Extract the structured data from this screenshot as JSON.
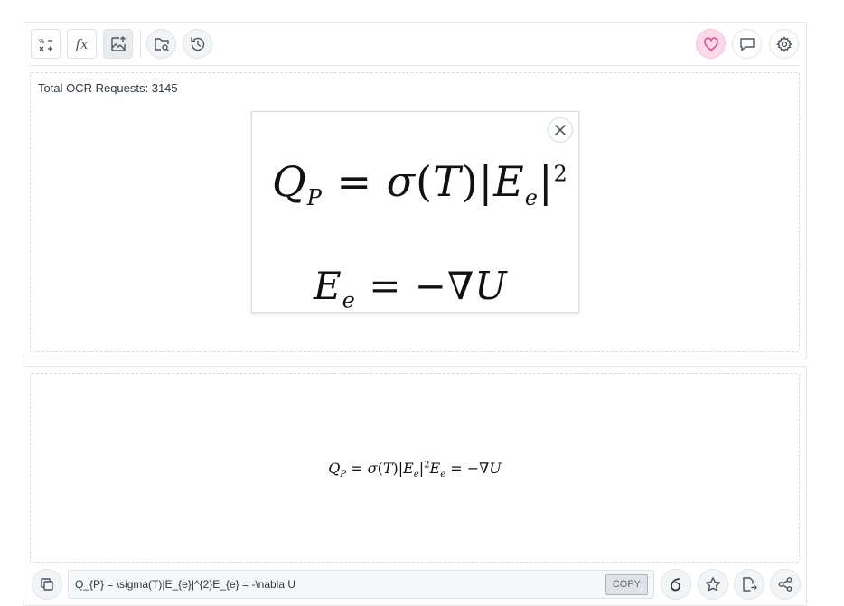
{
  "toolbar": {
    "left_buttons": [
      {
        "name": "math-symbols-icon",
        "glyph": "%−\n×+"
      },
      {
        "name": "fx-icon",
        "label": "fx"
      },
      {
        "name": "image-upload-icon"
      },
      {
        "name": "folder-search-icon"
      },
      {
        "name": "history-icon"
      }
    ],
    "right_buttons": [
      {
        "name": "heart-icon",
        "accent": "#e0468a"
      },
      {
        "name": "comment-icon"
      },
      {
        "name": "gear-icon"
      }
    ],
    "fx_label": "fx"
  },
  "ocr": {
    "counter_text": "Total OCR Requests: 3145"
  },
  "preview": {
    "close_icon": "close-icon"
  },
  "result": {
    "latex": "Q_{P} = \\sigma(T)|E_{e}|^{2}E_{e} = -\\nabla U",
    "copy_label": "COPY"
  },
  "bottom_buttons": [
    {
      "name": "copy-icon"
    },
    {
      "name": "overleaf-icon"
    },
    {
      "name": "star-icon"
    },
    {
      "name": "export-icon"
    },
    {
      "name": "share-icon"
    }
  ],
  "colors": {
    "accent_pink": "#fbd9e8",
    "border": "#dfe3e7"
  }
}
